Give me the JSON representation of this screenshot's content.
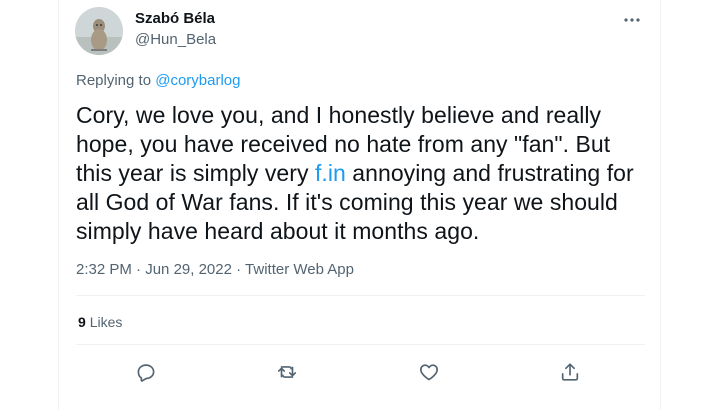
{
  "author": {
    "display_name": "Szabó Béla",
    "handle": "@Hun_Bela"
  },
  "reply": {
    "prefix": "Replying to ",
    "mention": "@corybarlog"
  },
  "tweet": {
    "text_before": "Cory, we love you, and I honestly believe and really hope, you have received no hate from any \"fan\". But this year is simply very ",
    "link": "f.in",
    "text_after": " annoying and frustrating for all God of War fans. If it's coming this year we should simply have heard about it months ago."
  },
  "meta": {
    "time": "2:32 PM",
    "sep1": " · ",
    "date": "Jun 29, 2022",
    "sep2": " · ",
    "source": "Twitter Web App"
  },
  "stats": {
    "likes_count": "9",
    "likes_label": "Likes"
  },
  "icons": {
    "more": "more-horizontal-icon",
    "reply": "reply-icon",
    "retweet": "retweet-icon",
    "like": "heart-icon",
    "share": "share-icon"
  },
  "colors": {
    "accent": "#1d9bf0",
    "text_primary": "#0f1419",
    "text_secondary": "#536471",
    "border": "#eff3f4"
  }
}
